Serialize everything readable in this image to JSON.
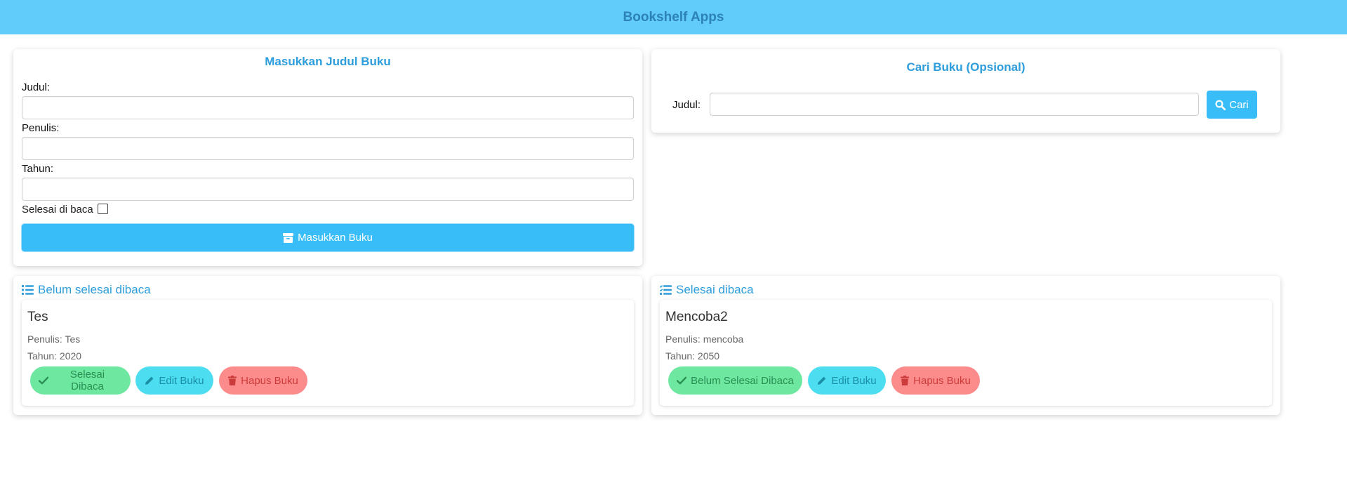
{
  "app": {
    "title": "Bookshelf Apps"
  },
  "input_form": {
    "title": "Masukkan Judul Buku",
    "judul_label": "Judul:",
    "penulis_label": "Penulis:",
    "tahun_label": "Tahun:",
    "judul_value": "",
    "penulis_value": "",
    "tahun_value": "",
    "selesai_label": "Selesai di baca",
    "selesai_checked": false,
    "submit_label": "Masukkan Buku"
  },
  "search": {
    "title": "Cari Buku (Opsional)",
    "judul_label": "Judul:",
    "value": "",
    "button_label": "Cari"
  },
  "shelves": {
    "incomplete": {
      "heading": "Belum selesai dibaca",
      "books": [
        {
          "title": "Tes",
          "author": "Penulis: Tes",
          "year": "Tahun: 2020",
          "toggle_label": "Selesai Dibaca",
          "edit_label": "Edit Buku",
          "delete_label": "Hapus Buku"
        }
      ]
    },
    "complete": {
      "heading": "Selesai dibaca",
      "books": [
        {
          "title": "Mencoba2",
          "author": "Penulis: mencoba",
          "year": "Tahun: 2050",
          "toggle_label": "Belum Selesai Dibaca",
          "edit_label": "Edit Buku",
          "delete_label": "Hapus Buku"
        }
      ]
    }
  },
  "colors": {
    "header_bg": "#61cbf9",
    "accent": "#38bdf8",
    "heading_text": "#2d9ddb",
    "green_pill": "#6ee7a0",
    "cyan_pill": "#4dddf0",
    "red_pill": "#fc8c8c"
  },
  "icons": {
    "submit": "archive-icon",
    "search": "search-icon",
    "incomplete_shelf": "list-icon",
    "complete_shelf": "list-check-icon",
    "toggle_done": "check-icon",
    "toggle_undone": "check-icon",
    "edit": "pencil-icon",
    "delete": "trash-icon"
  }
}
